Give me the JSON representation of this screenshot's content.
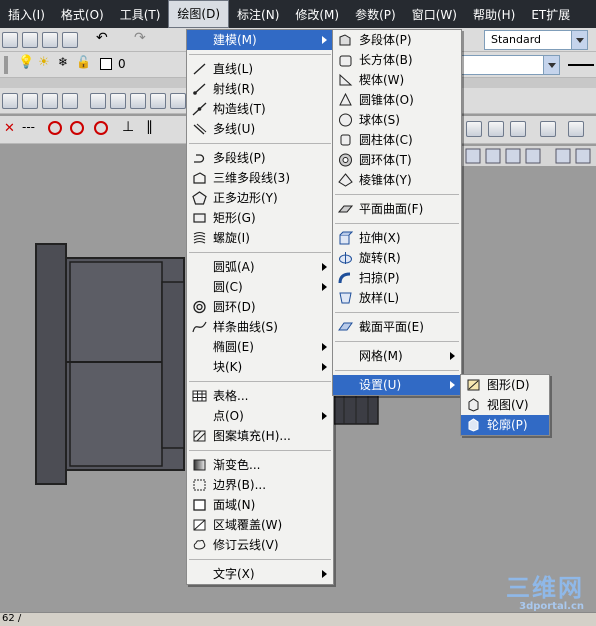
{
  "menubar": {
    "items": [
      {
        "label": "插入(I)"
      },
      {
        "label": "格式(O)"
      },
      {
        "label": "工具(T)"
      },
      {
        "label": "绘图(D)"
      },
      {
        "label": "标注(N)"
      },
      {
        "label": "修改(M)"
      },
      {
        "label": "参数(P)"
      },
      {
        "label": "窗口(W)"
      },
      {
        "label": "帮助(H)"
      },
      {
        "label": "ET扩展"
      }
    ]
  },
  "toolbar": {
    "style_combo": "Standard",
    "layer_value": "0",
    "layer_suffix": "er"
  },
  "draw_menu": {
    "items": [
      {
        "label": "建模(M)",
        "icon": "none",
        "submenu": true
      },
      {
        "label": "直线(L)",
        "icon": "line-icon"
      },
      {
        "label": "射线(R)",
        "icon": "ray-icon"
      },
      {
        "label": "构造线(T)",
        "icon": "xline-icon"
      },
      {
        "label": "多线(U)",
        "icon": "mline-icon"
      },
      {
        "label": "多段线(P)",
        "icon": "pline-icon"
      },
      {
        "label": "三维多段线(3)",
        "icon": "3dpoly-icon"
      },
      {
        "label": "正多边形(Y)",
        "icon": "polygon-icon"
      },
      {
        "label": "矩形(G)",
        "icon": "rectangle-icon"
      },
      {
        "label": "螺旋(I)",
        "icon": "helix-icon"
      },
      {
        "label": "圆弧(A)",
        "icon": "none",
        "submenu": true
      },
      {
        "label": "圆(C)",
        "icon": "none",
        "submenu": true
      },
      {
        "label": "圆环(D)",
        "icon": "donut-icon"
      },
      {
        "label": "样条曲线(S)",
        "icon": "spline-icon"
      },
      {
        "label": "椭圆(E)",
        "icon": "none",
        "submenu": true
      },
      {
        "label": "块(K)",
        "icon": "none",
        "submenu": true
      },
      {
        "label": "表格...",
        "icon": "table-icon"
      },
      {
        "label": "点(O)",
        "icon": "none",
        "submenu": true
      },
      {
        "label": "图案填充(H)...",
        "icon": "hatch-icon"
      },
      {
        "label": "渐变色...",
        "icon": "gradient-icon"
      },
      {
        "label": "边界(B)...",
        "icon": "boundary-icon"
      },
      {
        "label": "面域(N)",
        "icon": "region-icon"
      },
      {
        "label": "区域覆盖(W)",
        "icon": "wipeout-icon"
      },
      {
        "label": "修订云线(V)",
        "icon": "revcloud-icon"
      },
      {
        "label": "文字(X)",
        "icon": "none",
        "submenu": true
      }
    ]
  },
  "modeling_menu": {
    "items": [
      {
        "label": "多段体(P)",
        "icon": "polysolid-icon"
      },
      {
        "label": "长方体(B)",
        "icon": "box-icon"
      },
      {
        "label": "楔体(W)",
        "icon": "wedge-icon"
      },
      {
        "label": "圆锥体(O)",
        "icon": "cone-icon"
      },
      {
        "label": "球体(S)",
        "icon": "sphere-icon"
      },
      {
        "label": "圆柱体(C)",
        "icon": "cylinder-icon"
      },
      {
        "label": "圆环体(T)",
        "icon": "torus-icon"
      },
      {
        "label": "棱锥体(Y)",
        "icon": "pyramid-icon"
      },
      {
        "label": "平面曲面(F)",
        "icon": "planesurf-icon"
      },
      {
        "label": "拉伸(X)",
        "icon": "extrude-icon"
      },
      {
        "label": "旋转(R)",
        "icon": "revolve-icon"
      },
      {
        "label": "扫掠(P)",
        "icon": "sweep-icon"
      },
      {
        "label": "放样(L)",
        "icon": "loft-icon"
      },
      {
        "label": "截面平面(E)",
        "icon": "sectionplane-icon"
      },
      {
        "label": "网格(M)",
        "icon": "none",
        "submenu": true
      },
      {
        "label": "设置(U)",
        "icon": "none",
        "submenu": true
      }
    ]
  },
  "setup_menu": {
    "items": [
      {
        "label": "图形(D)",
        "icon": "drawing-icon"
      },
      {
        "label": "视图(V)",
        "icon": "view-icon"
      },
      {
        "label": "轮廓(P)",
        "icon": "profile-icon"
      }
    ]
  },
  "status": {
    "text": "62 /"
  },
  "watermark": {
    "title": "三维网",
    "url": "3dportal.cn"
  }
}
